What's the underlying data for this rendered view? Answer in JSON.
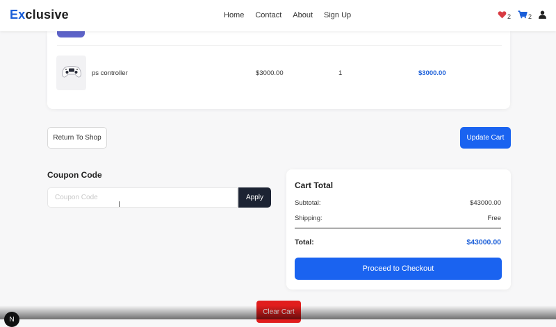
{
  "header": {
    "logo_prefix": "Ex",
    "logo_rest": "clusive",
    "nav": {
      "home": "Home",
      "contact": "Contact",
      "about": "About",
      "signup": "Sign Up"
    },
    "wishlist_count": "2",
    "cart_count": "2",
    "icons": {
      "wishlist": "heart-icon",
      "cart": "cart-icon",
      "account": "user-icon"
    },
    "colors": {
      "logo_accent": "#1a5ed8",
      "heart": "#d83b43",
      "cart": "#1a5ed8"
    }
  },
  "cart": {
    "items": [
      {
        "name": "ps controller",
        "price": "$3000.00",
        "quantity": "1",
        "subtotal": "$3000.00",
        "image_icon": "gamepad-icon"
      }
    ]
  },
  "actions": {
    "return_label": "Return To Shop",
    "update_label": "Update Cart",
    "clear_label": "Clear Cart"
  },
  "coupon": {
    "title": "Coupon Code",
    "placeholder": "Coupon Code",
    "value": "",
    "apply_label": "Apply"
  },
  "totals": {
    "title": "Cart Total",
    "subtotal_label": "Subtotal:",
    "subtotal_value": "$43000.00",
    "shipping_label": "Shipping:",
    "shipping_value": "Free",
    "total_label": "Total:",
    "total_value": "$43000.00",
    "checkout_label": "Proceed to Checkout"
  },
  "colors": {
    "primary": "#1a63f0",
    "dark": "#1c2333",
    "danger": "#e11d1d"
  },
  "badge": "N"
}
